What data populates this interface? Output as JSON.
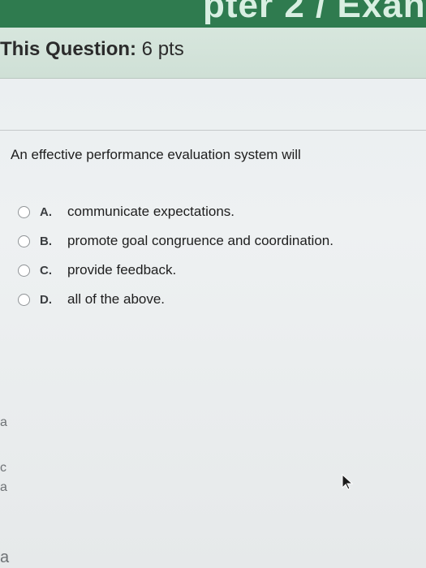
{
  "header": {
    "banner_title": "pter 2 / Exan"
  },
  "points": {
    "label": "This Question:",
    "value": "6 pts"
  },
  "question": {
    "text": "An effective performance evaluation system will"
  },
  "options": [
    {
      "letter": "A.",
      "text": "communicate expectations."
    },
    {
      "letter": "B.",
      "text": "promote goal congruence and coordination."
    },
    {
      "letter": "C.",
      "text": "provide feedback."
    },
    {
      "letter": "D.",
      "text": "all of the above."
    }
  ],
  "left_fragments": [
    "a",
    "c",
    "a",
    "a"
  ]
}
